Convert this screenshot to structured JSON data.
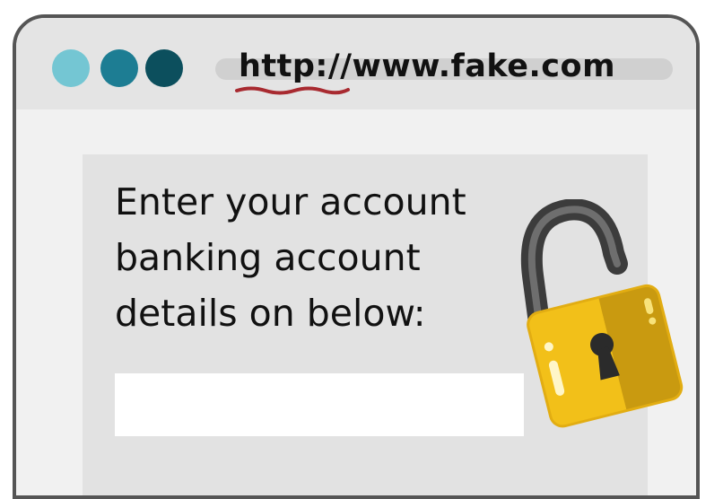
{
  "browser": {
    "window_controls": [
      {
        "name": "dot-light",
        "color": "#74c6d3"
      },
      {
        "name": "dot-mid",
        "color": "#1d7d93"
      },
      {
        "name": "dot-dark",
        "color": "#0c4f5d"
      }
    ],
    "address_bar": {
      "url": "http://www.fake.com",
      "underline_color": "#a82a30"
    }
  },
  "form": {
    "prompt_lines": [
      "Enter your account",
      "banking account",
      "details on below:"
    ],
    "input": {
      "value": "",
      "placeholder": ""
    }
  },
  "icons": {
    "lock": {
      "name": "unlocked-padlock-icon",
      "body_color": "#f2c019",
      "shackle_color": "#4a4a4a"
    }
  }
}
